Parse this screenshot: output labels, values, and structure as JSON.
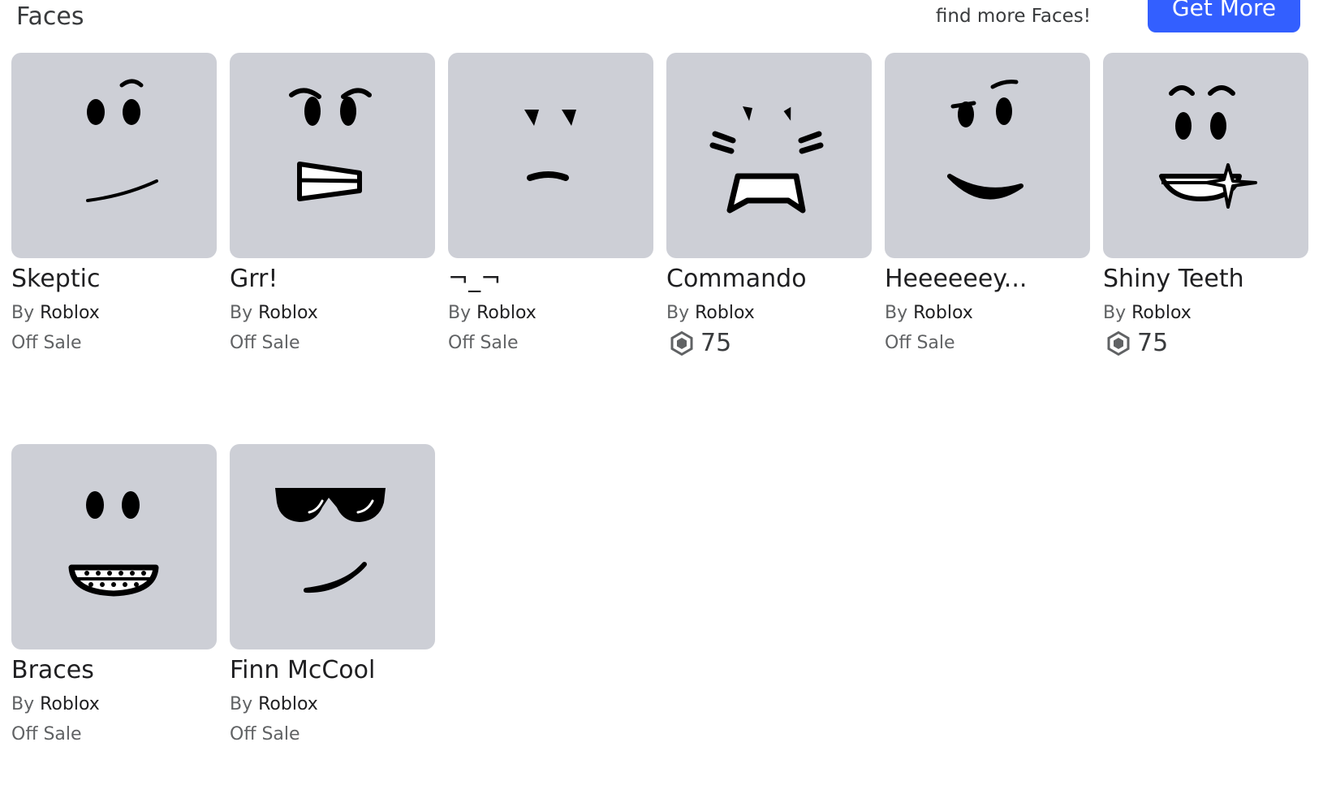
{
  "header": {
    "title": "Faces",
    "promo_text": "find more Faces!",
    "get_more_label": "Get More"
  },
  "items": [
    {
      "name": "Skeptic",
      "by": "By",
      "creator": "Roblox",
      "status": "Off Sale",
      "price": null,
      "face": "skeptic"
    },
    {
      "name": "Grr!",
      "by": "By",
      "creator": "Roblox",
      "status": "Off Sale",
      "price": null,
      "face": "grr"
    },
    {
      "name": "¬_¬",
      "by": "By",
      "creator": "Roblox",
      "status": "Off Sale",
      "price": null,
      "face": "side-eye"
    },
    {
      "name": "Commando",
      "by": "By",
      "creator": "Roblox",
      "status": null,
      "price": "75",
      "face": "commando"
    },
    {
      "name": "Heeeeeey...",
      "by": "By",
      "creator": "Roblox",
      "status": "Off Sale",
      "price": null,
      "face": "heeeeeey"
    },
    {
      "name": "Shiny Teeth",
      "by": "By",
      "creator": "Roblox",
      "status": null,
      "price": "75",
      "face": "shiny-teeth"
    },
    {
      "name": "Braces",
      "by": "By",
      "creator": "Roblox",
      "status": "Off Sale",
      "price": null,
      "face": "braces"
    },
    {
      "name": "Finn McCool",
      "by": "By",
      "creator": "Roblox",
      "status": "Off Sale",
      "price": null,
      "face": "finn-mccool"
    }
  ],
  "colors": {
    "accent": "#335fff",
    "thumb_bg": "#cdcfd6"
  }
}
